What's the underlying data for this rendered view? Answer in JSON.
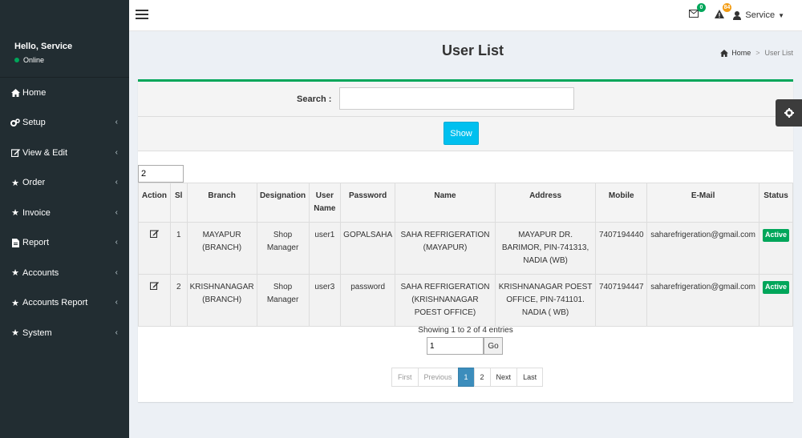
{
  "sidebar": {
    "greeting": "Hello, Service",
    "status": "Online",
    "items": [
      {
        "label": "Home",
        "icon": "home-icon",
        "has_children": false
      },
      {
        "label": "Setup",
        "icon": "cogs-icon",
        "has_children": true
      },
      {
        "label": "View & Edit",
        "icon": "edit-icon",
        "has_children": true
      },
      {
        "label": "Order",
        "icon": "star-icon",
        "has_children": true
      },
      {
        "label": "Invoice",
        "icon": "star-icon",
        "has_children": true
      },
      {
        "label": "Report",
        "icon": "file-icon",
        "has_children": true
      },
      {
        "label": "Accounts",
        "icon": "star-icon",
        "has_children": true
      },
      {
        "label": "Accounts Report",
        "icon": "star-icon",
        "has_children": true
      },
      {
        "label": "System",
        "icon": "star-icon",
        "has_children": true
      }
    ]
  },
  "topbar": {
    "mail_count": "0",
    "alert_count": "84",
    "user_label": "Service"
  },
  "header": {
    "title": "User List",
    "breadcrumb_home": "Home",
    "breadcrumb_current": "User List"
  },
  "search": {
    "label": "Search :",
    "value": "",
    "show_label": "Show"
  },
  "table": {
    "page_length": "2",
    "columns": [
      "Action",
      "Sl",
      "Branch",
      "Designation",
      "User Name",
      "Password",
      "Name",
      "Address",
      "Mobile",
      "E-Mail",
      "Status"
    ],
    "rows": [
      {
        "sl": "1",
        "branch": "MAYAPUR (BRANCH)",
        "designation": "Shop Manager",
        "username": "user1",
        "password": "GOPALSAHA",
        "name": "SAHA REFRIGERATION (MAYAPUR)",
        "address": "MAYAPUR DR. BARIMOR, PIN-741313, NADIA (WB)",
        "mobile": "7407194440",
        "email": "saharefrigeration@gmail.com",
        "status": "Active"
      },
      {
        "sl": "2",
        "branch": "KRISHNANAGAR (BRANCH)",
        "designation": "Shop Manager",
        "username": "user3",
        "password": "password",
        "name": "SAHA REFRIGERATION (KRISHNANAGAR POEST OFFICE)",
        "address": "KRISHNANAGAR POEST OFFICE, PIN-741101. NADIA ( WB)",
        "mobile": "7407194447",
        "email": "saharefrigeration@gmail.com",
        "status": "Active"
      }
    ]
  },
  "footer": {
    "info": "Showing 1 to 2 of 4 entries",
    "go_value": "1",
    "go_label": "Go",
    "pages": [
      "First",
      "Previous",
      "1",
      "2",
      "Next",
      "Last"
    ]
  },
  "colors": {
    "sidebar_bg": "#222d32",
    "accent_green": "#00a65a",
    "show_button": "#00c0ef",
    "page_current": "#3c8dbc"
  }
}
